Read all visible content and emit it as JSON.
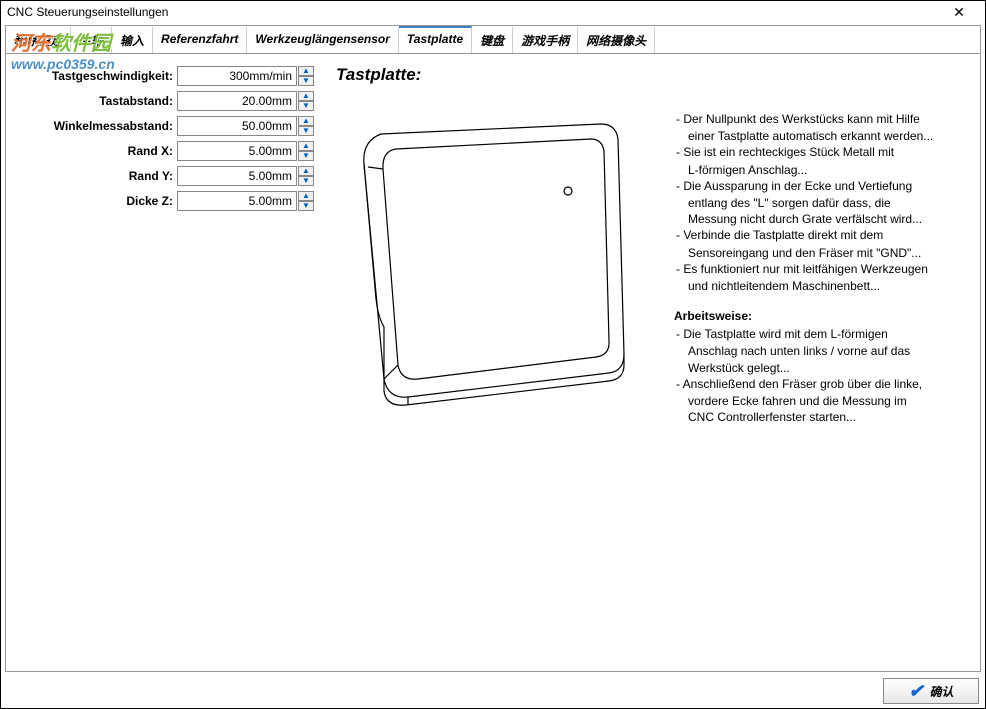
{
  "window": {
    "title": "CNC Steuerungseinstellungen"
  },
  "watermark": {
    "line1a": "河东",
    "line1b": "软件园",
    "line2": "www.pc0359.cn"
  },
  "tabs": {
    "items": [
      {
        "label": "程序设定"
      },
      {
        "label": "主轴"
      },
      {
        "label": "输入"
      },
      {
        "label": "Referenzfahrt"
      },
      {
        "label": "Werkzeuglängensensor"
      },
      {
        "label": "Tastplatte"
      },
      {
        "label": "键盘"
      },
      {
        "label": "游戏手柄"
      },
      {
        "label": "网络摄像头"
      }
    ],
    "activeIndex": 5
  },
  "heading": "Tastplatte:",
  "form": {
    "rows": [
      {
        "label": "Tastgeschwindigkeit:",
        "value": "300mm/min"
      },
      {
        "label": "Tastabstand:",
        "value": "20.00mm"
      },
      {
        "label": "Winkelmessabstand:",
        "value": "50.00mm"
      },
      {
        "label": "Rand X:",
        "value": "5.00mm"
      },
      {
        "label": "Rand Y:",
        "value": "5.00mm"
      },
      {
        "label": "Dicke Z:",
        "value": "5.00mm"
      }
    ]
  },
  "info": {
    "b1a": "- Der Nullpunkt des Werkstücks kann mit Hilfe",
    "b1b": "einer Tastplatte automatisch erkannt werden...",
    "b2a": "- Sie ist ein rechteckiges Stück Metall mit",
    "b2b": "L-förmigen Anschlag...",
    "b3a": "- Die Aussparung in der Ecke und Vertiefung",
    "b3b": "entlang des \"L\" sorgen dafür dass, die",
    "b3c": "Messung nicht durch Grate verfälscht wird...",
    "b4a": "- Verbinde die Tastplatte direkt mit dem",
    "b4b": "Sensoreingang und den Fräser mit \"GND\"...",
    "b5a": "- Es funktioniert nur mit leitfähigen Werkzeugen",
    "b5b": "und nichtleitendem Maschinenbett...",
    "workTitle": "Arbeitsweise:",
    "w1a": "- Die Tastplatte wird mit dem L-förmigen",
    "w1b": "Anschlag nach unten links / vorne auf das",
    "w1c": "Werkstück gelegt...",
    "w2a": "- Anschließend den Fräser grob über die linke,",
    "w2b": "vordere Ecke fahren und die Messung im",
    "w2c": "CNC Controllerfenster starten..."
  },
  "footer": {
    "ok": "确认"
  }
}
